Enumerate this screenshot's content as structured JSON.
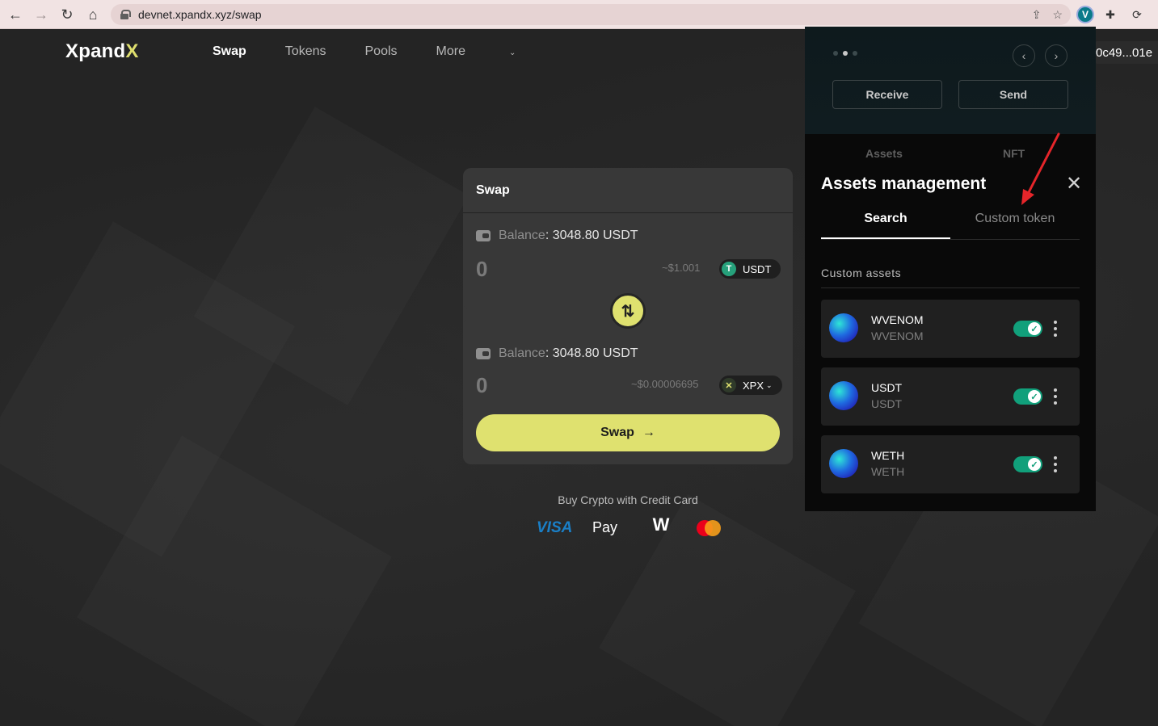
{
  "browser": {
    "url": "devnet.xpandx.xyz/swap",
    "ext_v": "V"
  },
  "site": {
    "logo_main": "Xpand",
    "logo_x": "X",
    "nav": [
      "Swap",
      "Tokens",
      "Pools",
      "More"
    ],
    "address": "0c49...01e"
  },
  "swap": {
    "title": "Swap",
    "from": {
      "balance_label": "Balance",
      "balance_value": ": 3048.80 USDT",
      "amount": "0",
      "usd": "~$1.001",
      "token": "USDT"
    },
    "to": {
      "balance_label": "Balance",
      "balance_value": ": 3048.80 USDT",
      "amount": "0",
      "usd": "~$0.00006695",
      "token": "XPX"
    },
    "action_label": "Swap",
    "buy_text": "Buy Crypto with Credit Card",
    "payments": [
      "VISA",
      "Pay"
    ]
  },
  "wallet": {
    "receive": "Receive",
    "send": "Send",
    "tabs_behind": [
      "Assets",
      "NFT"
    ],
    "panel_title": "Assets management",
    "panel_tabs": [
      "Search",
      "Custom token"
    ],
    "section_label": "Custom assets",
    "assets": [
      {
        "name": "WVENOM",
        "symbol": "WVENOM",
        "enabled": true
      },
      {
        "name": "USDT",
        "symbol": "USDT",
        "enabled": true
      },
      {
        "name": "WETH",
        "symbol": "WETH",
        "enabled": true
      }
    ]
  },
  "colors": {
    "accent": "#dfe16f",
    "toggle": "#11a07b",
    "usdt": "#26a17b",
    "annotation": "#e5252a"
  }
}
